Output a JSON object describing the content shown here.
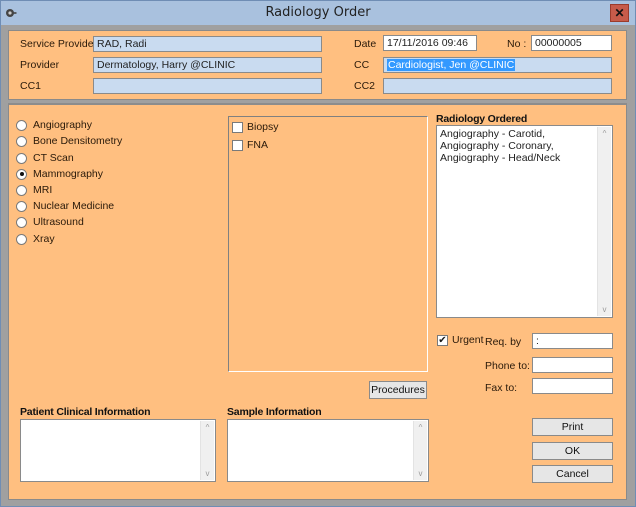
{
  "window": {
    "title": "Radiology Order",
    "close_glyph": "✕",
    "app_icon": "gear-key-icon"
  },
  "header": {
    "service_provider": {
      "label": "Service Provider",
      "value": "RAD, Radi"
    },
    "provider": {
      "label": "Provider",
      "value": "Dermatology, Harry @CLINIC"
    },
    "cc1": {
      "label": "CC1",
      "value": ""
    },
    "date": {
      "label": "Date",
      "value": "17/11/2016 09:46"
    },
    "no": {
      "label": "No :",
      "value": "00000005"
    },
    "cc": {
      "label": "CC",
      "value": "Cardiologist, Jen @CLINIC"
    },
    "cc2": {
      "label": "CC2",
      "value": ""
    }
  },
  "modalities": {
    "selected": "Mammography",
    "items": [
      {
        "label": "Angiography",
        "checked": false
      },
      {
        "label": "Bone Densitometry",
        "checked": false
      },
      {
        "label": "CT Scan",
        "checked": false
      },
      {
        "label": "Mammography",
        "checked": true
      },
      {
        "label": "MRI",
        "checked": false
      },
      {
        "label": "Nuclear Medicine",
        "checked": false
      },
      {
        "label": "Ultrasound",
        "checked": false
      },
      {
        "label": "Xray",
        "checked": false
      }
    ]
  },
  "procedures": {
    "items": [
      {
        "label": "Biopsy",
        "checked": false
      },
      {
        "label": "FNA",
        "checked": false
      }
    ],
    "button_label": "Procedures"
  },
  "radiology_ordered": {
    "title": "Radiology Ordered",
    "lines": [
      "Angiography - Carotid,",
      "Angiography - Coronary,",
      "Angiography - Head/Neck"
    ]
  },
  "urgent": {
    "label": "Urgent",
    "checked": true
  },
  "req_by": {
    "label": "Req. by",
    "value": ":"
  },
  "phone_to": {
    "label": "Phone to:",
    "value": ""
  },
  "fax_to": {
    "label": "Fax to:",
    "value": ""
  },
  "patient_clinical": {
    "title": "Patient Clinical Information",
    "value": ""
  },
  "sample_info": {
    "title": "Sample Information",
    "value": ""
  },
  "buttons": {
    "print": "Print",
    "ok": "OK",
    "cancel": "Cancel"
  },
  "scroll_glyphs": {
    "up": "^",
    "down": "v"
  }
}
